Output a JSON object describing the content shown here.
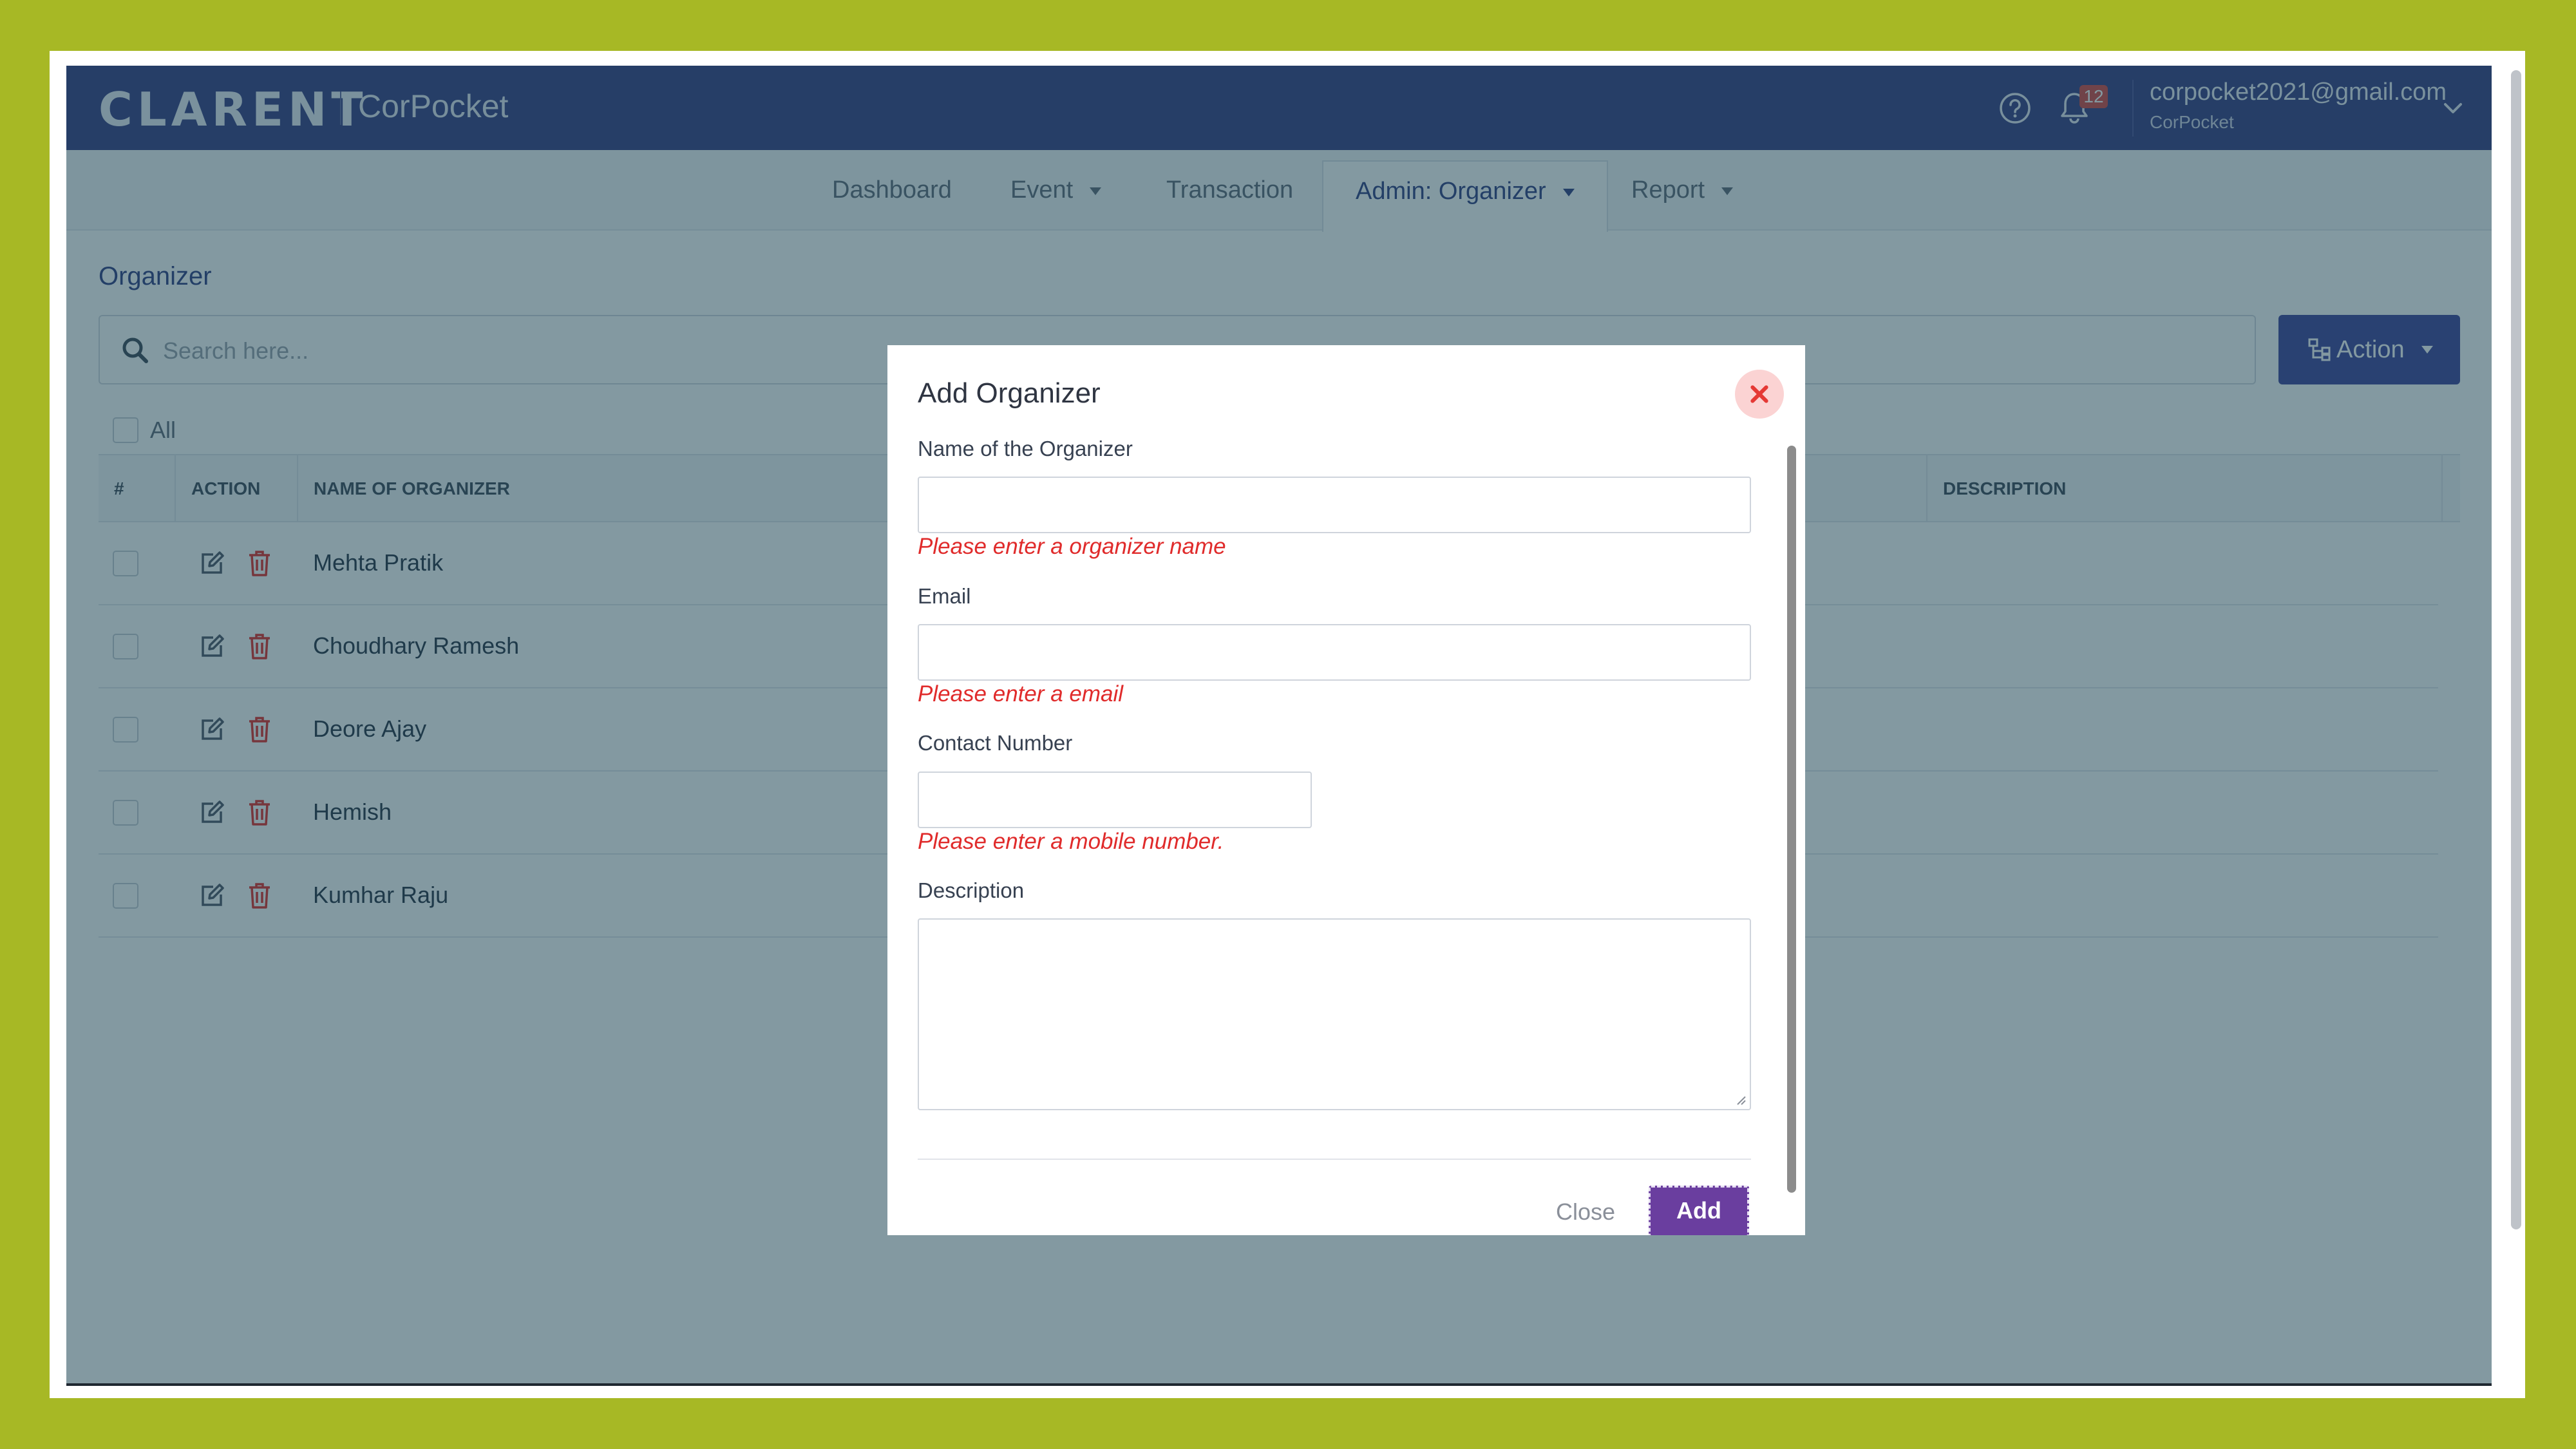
{
  "header": {
    "logo": "CLARENT",
    "app_name": "CorPocket",
    "notification_count": "12",
    "user_email": "corpocket2021@gmail.com",
    "user_org": "CorPocket"
  },
  "nav": {
    "dashboard": "Dashboard",
    "event": "Event",
    "transaction": "Transaction",
    "admin_organizer": "Admin: Organizer",
    "report": "Report"
  },
  "page": {
    "title": "Organizer",
    "search_placeholder": "Search here...",
    "action_label": "Action",
    "all_label": "All"
  },
  "table": {
    "headers": [
      "#",
      "ACTION",
      "NAME OF ORGANIZER",
      "DESCRIPTION"
    ],
    "rows": [
      {
        "name": "Mehta Pratik"
      },
      {
        "name": "Choudhary Ramesh"
      },
      {
        "name": "Deore Ajay"
      },
      {
        "name": "Hemish"
      },
      {
        "name": "Kumhar Raju"
      }
    ]
  },
  "modal": {
    "title": "Add Organizer",
    "name_label": "Name of the Organizer",
    "name_value": "",
    "name_error": "Please enter a organizer name",
    "email_label": "Email",
    "email_value": "",
    "email_error": "Please enter a email",
    "contact_label": "Contact Number",
    "contact_value": "",
    "contact_error": "Please enter a mobile number.",
    "description_label": "Description",
    "description_value": "",
    "close_label": "Close",
    "add_label": "Add"
  },
  "colors": {
    "frame": "#a7b825",
    "header_bg": "#44488a",
    "primary": "#4a4fa0",
    "add_button": "#6a3e9f",
    "error": "#e02b2b",
    "delete_icon": "#e53935"
  },
  "icons": [
    "help-icon",
    "bell-icon",
    "chevron-down-icon",
    "search-icon",
    "org-chart-icon",
    "edit-icon",
    "trash-icon",
    "close-icon"
  ]
}
